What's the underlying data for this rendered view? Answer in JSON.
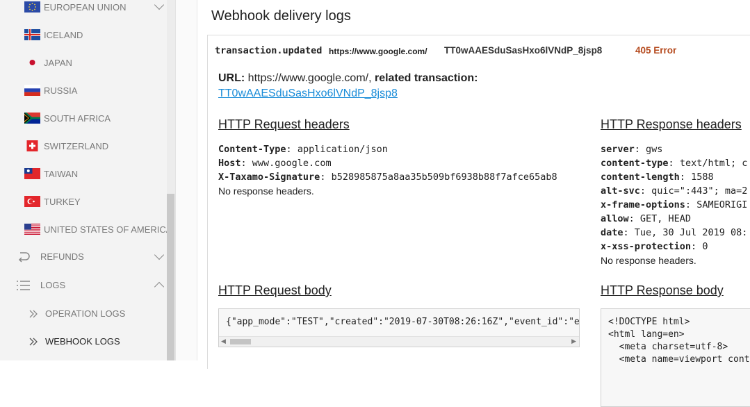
{
  "sidebar": {
    "countries": [
      {
        "label": "EUROPEAN UNION",
        "flag": "eu-flag-icon"
      },
      {
        "label": "ICELAND",
        "flag": "iceland-flag-icon"
      },
      {
        "label": "JAPAN",
        "flag": "japan-flag-icon"
      },
      {
        "label": "RUSSIA",
        "flag": "russia-flag-icon"
      },
      {
        "label": "SOUTH AFRICA",
        "flag": "south-africa-flag-icon"
      },
      {
        "label": "SWITZERLAND",
        "flag": "switzerland-flag-icon"
      },
      {
        "label": "TAIWAN",
        "flag": "taiwan-flag-icon"
      },
      {
        "label": "TURKEY",
        "flag": "turkey-flag-icon"
      },
      {
        "label": "UNITED STATES OF AMERICA",
        "flag": "usa-flag-icon"
      }
    ],
    "refunds_label": "REFUNDS",
    "logs_label": "LOGS",
    "operation_logs_label": "OPERATION LOGS",
    "webhook_logs_label": "WEBHOOK LOGS"
  },
  "main": {
    "title": "Webhook delivery logs",
    "summary": {
      "event": "transaction.updated",
      "url": "https://www.google.com/",
      "transaction": "TT0wAAESduSasHxo6lVNdP_8jsp8",
      "status": "405 Error"
    },
    "url_line": {
      "url_label": "URL:",
      "url": "https://www.google.com/,",
      "related_label": "related transaction:",
      "transaction_link": "TT0wAAESduSasHxo6lVNdP_8jsp8"
    },
    "request_headers": {
      "title": "HTTP Request headers",
      "items": [
        {
          "key": "Content-Type",
          "value": "application/json"
        },
        {
          "key": "Host",
          "value": "www.google.com"
        },
        {
          "key": "X-Taxamo-Signature",
          "value": "b528985875a8aa35b509bf6938b88f7afce65ab8"
        }
      ],
      "note": "No response headers."
    },
    "response_headers": {
      "title": "HTTP Response headers",
      "items": [
        {
          "key": "server",
          "value": "gws"
        },
        {
          "key": "content-type",
          "value": "text/html; c"
        },
        {
          "key": "content-length",
          "value": "1588"
        },
        {
          "key": "alt-svc",
          "value": "quic=\":443\"; ma=2"
        },
        {
          "key": "x-frame-options",
          "value": "SAMEORIGI"
        },
        {
          "key": "allow",
          "value": "GET, HEAD"
        },
        {
          "key": "date",
          "value": "Tue, 30 Jul 2019 08:"
        },
        {
          "key": "x-xss-protection",
          "value": "0"
        }
      ],
      "note": "No response headers."
    },
    "request_body": {
      "title": "HTTP Request body",
      "text": "{\"app_mode\":\"TEST\",\"created\":\"2019-07-30T08:26:16Z\",\"event_id\":\"e"
    },
    "response_body": {
      "title": "HTTP Response body",
      "lines": [
        "<!DOCTYPE html>",
        "<html lang=en>",
        "  <meta charset=utf-8>",
        "  <meta name=viewport conte"
      ]
    }
  }
}
